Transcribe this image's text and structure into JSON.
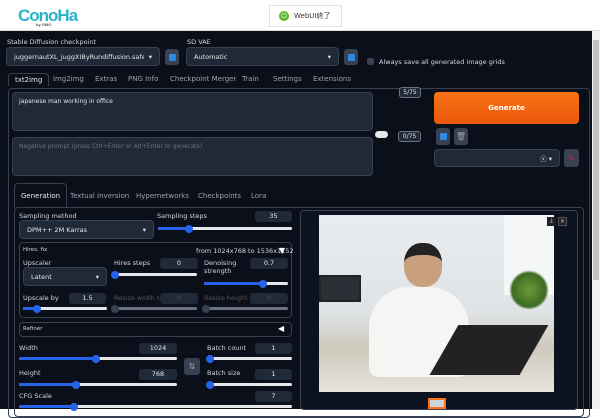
{
  "header": {
    "logo": "ConoHa",
    "logo_sub": "by GMO",
    "end_button": "WebUI終了"
  },
  "top": {
    "checkpoint_label": "Stable Diffusion checkpoint",
    "checkpoint_value": "juggernautXL_juggXIByRundiffusion.safetensor",
    "vae_label": "SD VAE",
    "vae_value": "Automatic",
    "save_grids_label": "Always save all generated image grids",
    "save_grids_checked": false
  },
  "tabs": [
    "txt2img",
    "img2img",
    "Extras",
    "PNG Info",
    "Checkpoint Merger",
    "Train",
    "Settings",
    "Extensions"
  ],
  "prompt": {
    "value": "japanese man working in office",
    "count": "5/75",
    "negative_placeholder": "Negative prompt (press Ctrl+Enter or Alt+Enter to generate)",
    "negative_count": "0/75",
    "generate": "Generate"
  },
  "subtabs": [
    "Generation",
    "Textual Inversion",
    "Hypernetworks",
    "Checkpoints",
    "Lora"
  ],
  "gen": {
    "sampling_method_label": "Sampling method",
    "sampling_method": "DPM++ 2M Karras",
    "sampling_steps_label": "Sampling steps",
    "sampling_steps": "35",
    "sampling_steps_frac": 0.23,
    "hires_label": "Hires. fix",
    "hires_info": "from 1024x768  to 1536x1152",
    "upscaler_label": "Upscaler",
    "upscaler": "Latent",
    "hires_steps_label": "Hires steps",
    "hires_steps": "0",
    "hires_steps_frac": 0,
    "denoise_label": "Denoising strength",
    "denoise": "0.7",
    "denoise_frac": 0.7,
    "upscale_by_label": "Upscale by",
    "upscale_by": "1.5",
    "upscale_by_frac": 0.17,
    "resize_w_label": "Resize width to",
    "resize_w": "0",
    "resize_h_label": "Resize height to",
    "resize_h": "0",
    "refiner_label": "Refiner",
    "width_label": "Width",
    "width": "1024",
    "width_frac": 0.49,
    "height_label": "Height",
    "height": "768",
    "height_frac": 0.36,
    "batch_count_label": "Batch count",
    "batch_count": "1",
    "batch_size_label": "Batch size",
    "batch_size": "1",
    "cfg_label": "CFG Scale",
    "cfg": "7",
    "cfg_frac": 0.2
  },
  "colors": {
    "accent": "#2563eb",
    "generate": "#f97316",
    "bg": "#0b0f19"
  }
}
